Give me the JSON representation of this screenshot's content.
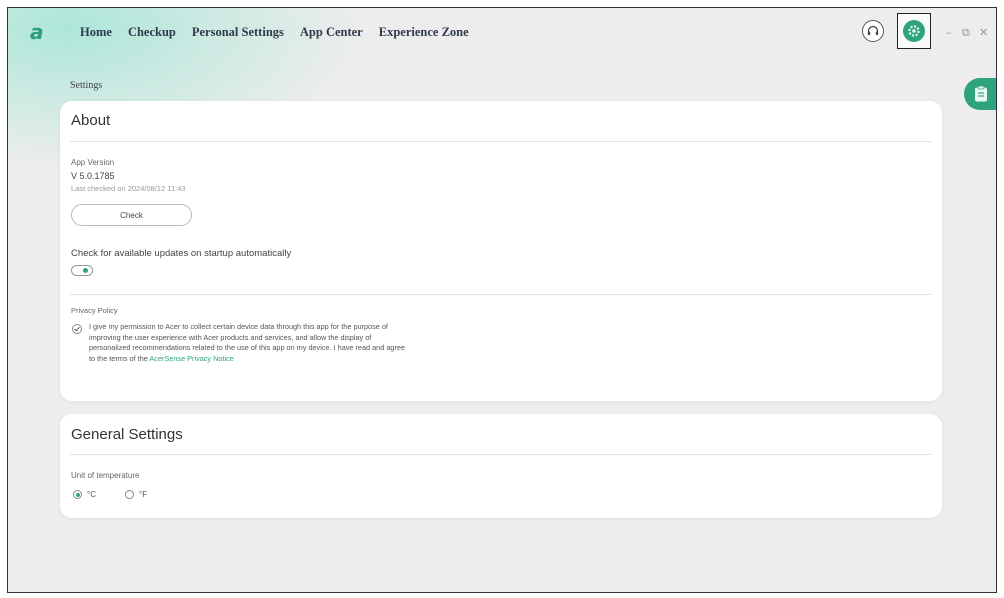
{
  "logo": "a",
  "nav": [
    "Home",
    "Checkup",
    "Personal Settings",
    "App Center",
    "Experience Zone"
  ],
  "window_controls": {
    "minimize": "–",
    "restore": "⧉",
    "close": "✕"
  },
  "icons": {
    "support": "headset-icon",
    "settings": "gear-icon",
    "side_panel": "clipboard-icon"
  },
  "colors": {
    "accent": "#2fa37e"
  },
  "breadcrumb": "Settings",
  "about": {
    "title": "About",
    "app_version_label": "App Version",
    "version": "V 5.0.1785",
    "last_checked": "Last checked on 2024/08/12 11:43",
    "check_button": "Check",
    "auto_update_label": "Check for available updates on startup automatically",
    "auto_update_enabled": true,
    "privacy_label": "Privacy Policy",
    "privacy_checked": true,
    "privacy_text": "I give my permission to Acer to collect certain device data through this app for the purpose of improving the user experience with Acer products and services, and allow the display of personalized recommendations related to the use of this app on my device. I have read and agree to the terms of the ",
    "privacy_link": "AcerSense Privacy Notice"
  },
  "general": {
    "title": "General Settings",
    "unit_label": "Unit of temperature",
    "options": [
      "°C",
      "°F"
    ],
    "selected": "°C"
  }
}
